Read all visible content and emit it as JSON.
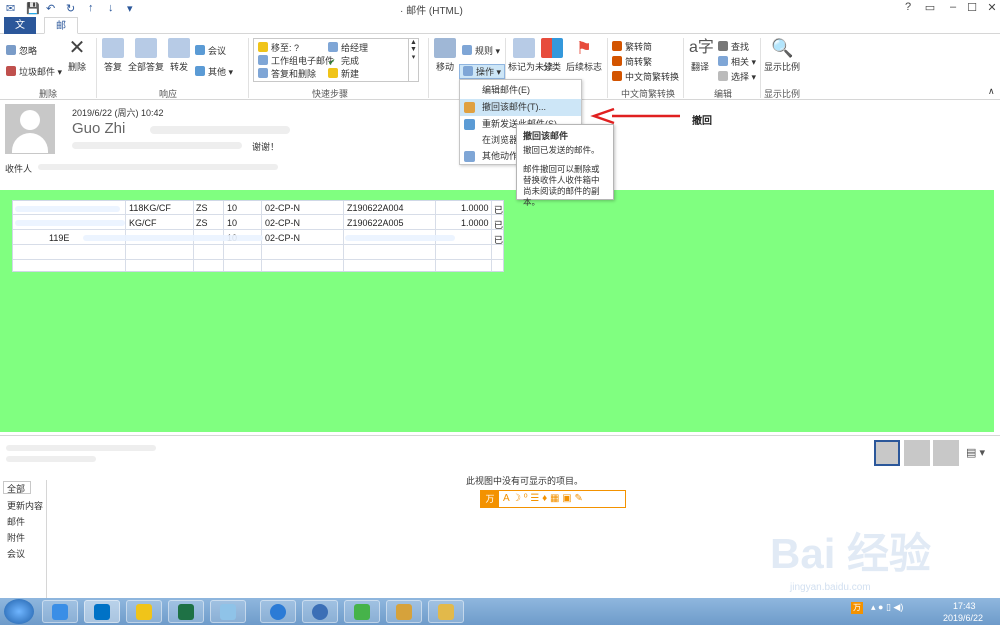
{
  "window": {
    "title": "· 邮件 (HTML)",
    "help": "?",
    "minimize": "–",
    "maximize": "☐",
    "close": "✕"
  },
  "tabs": {
    "file": "文件",
    "mail": "邮件"
  },
  "ribbon": {
    "delete_group": {
      "ignore": "忽略",
      "junk": "垃圾邮件",
      "delete": "删除",
      "label": "删除"
    },
    "respond_group": {
      "reply": "答复",
      "reply_all": "全部答复",
      "forward": "转发",
      "meeting": "会议",
      "more": "其他",
      "label": "响应"
    },
    "quicksteps": {
      "items": [
        "移至: ?",
        "给经理",
        "工作组电子邮件",
        "完成",
        "答复和删除",
        "新建"
      ],
      "label": "快速步骤"
    },
    "move_group": {
      "move": "移动",
      "rules": "规则",
      "actions": "操作"
    },
    "tags_group": {
      "mark_unread": "标记为未读",
      "categorize": "分类",
      "follow_up": "后续标志"
    },
    "chinese_group": {
      "to_traditional": "繁转简",
      "to_simplified": "简转繁",
      "conversion": "中文简繁转换",
      "label": "中文简繁转换"
    },
    "editing_group": {
      "translate": "翻译",
      "find": "查找",
      "related": "相关",
      "select": "选择",
      "label": "编辑"
    },
    "zoom_group": {
      "zoom": "显示比例",
      "label": "显示比例"
    }
  },
  "message": {
    "date": "2019/6/22 (周六) 10:42",
    "sender": "Guo Zhi",
    "subject_tail": "谢谢！",
    "to_label": "收件人"
  },
  "table": {
    "rows": [
      [
        "118KG/CF",
        "ZS",
        "10",
        "02-CP-N",
        "Z190622A004",
        "1.0000",
        "已"
      ],
      [
        "KG/CF",
        "ZS",
        "10",
        "02-CP-N",
        "Z190622A005",
        "1.0000",
        "已"
      ],
      [
        "119E",
        "",
        "10",
        "02-CP-N",
        "",
        "",
        "已"
      ]
    ]
  },
  "menu": {
    "items": [
      "编辑邮件(E)",
      "撤回该邮件(T)...",
      "重新发送此邮件(S)...",
      "在浏览器中查看",
      "其他动作"
    ]
  },
  "tooltip": {
    "title": "撤回该邮件",
    "desc": "撤回已发送的邮件。",
    "explain": "邮件撤回可以删除或替换收件人收件箱中尚未阅读的邮件的副本。"
  },
  "annotation": {
    "label": "撤回",
    "arrow_color": "#e02020"
  },
  "people": {
    "tabs": [
      "全部",
      "更新内容",
      "邮件",
      "附件",
      "会议"
    ],
    "empty": "此视图中没有可显示的项目。"
  },
  "taskbar": {
    "time": "17:43",
    "date": "2019/6/22"
  },
  "watermark": {
    "brand": "Bai 经验",
    "url": "jingyan.baidu.com"
  },
  "colors": {
    "accent": "#2b579a",
    "green_bg": "#80ff80",
    "menu_highlight": "#cde6f7",
    "social_border": "#f39200"
  }
}
